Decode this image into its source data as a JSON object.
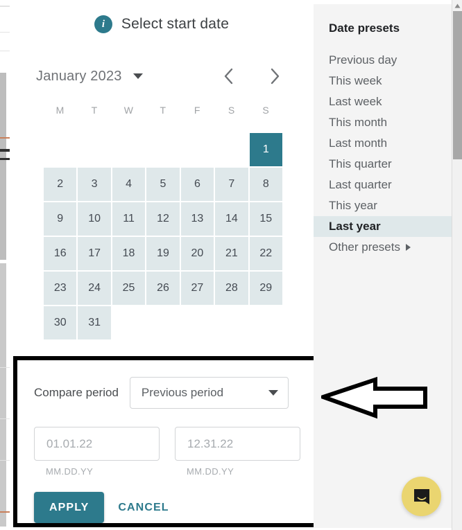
{
  "calendar": {
    "header_title": "Select start date",
    "info_icon": "info-icon",
    "month_label": "January 2023",
    "prev_icon": "chevron-left-icon",
    "next_icon": "chevron-right-icon",
    "dropdown_icon": "chevron-down-icon",
    "weekdays": [
      "M",
      "T",
      "W",
      "T",
      "F",
      "S",
      "S"
    ],
    "leading_blanks": 6,
    "days": [
      1,
      2,
      3,
      4,
      5,
      6,
      7,
      8,
      9,
      10,
      11,
      12,
      13,
      14,
      15,
      16,
      17,
      18,
      19,
      20,
      21,
      22,
      23,
      24,
      25,
      26,
      27,
      28,
      29,
      30,
      31
    ],
    "selected_day": 1,
    "in_range_days": [
      2,
      3,
      4,
      5,
      6,
      7,
      8,
      9,
      10,
      11,
      12,
      13,
      14,
      15,
      16,
      17,
      18,
      19,
      20,
      21,
      22,
      23,
      24,
      25,
      26,
      27,
      28,
      29,
      30,
      31
    ],
    "accent_color": "#2d7a8c",
    "range_color": "#dfe8ea"
  },
  "compare": {
    "label": "Compare period",
    "select_value": "Previous period",
    "select_icon": "chevron-down-icon",
    "start_date": {
      "value": "",
      "placeholder": "01.01.22",
      "hint": "MM.DD.YY"
    },
    "end_date": {
      "value": "",
      "placeholder": "12.31.22",
      "hint": "MM.DD.YY"
    },
    "apply_label": "APPLY",
    "cancel_label": "CANCEL"
  },
  "sidebar": {
    "title": "Date presets",
    "items": [
      {
        "label": "Previous day",
        "active": false,
        "submenu": false
      },
      {
        "label": "This week",
        "active": false,
        "submenu": false
      },
      {
        "label": "Last week",
        "active": false,
        "submenu": false
      },
      {
        "label": "This month",
        "active": false,
        "submenu": false
      },
      {
        "label": "Last month",
        "active": false,
        "submenu": false
      },
      {
        "label": "This quarter",
        "active": false,
        "submenu": false
      },
      {
        "label": "Last quarter",
        "active": false,
        "submenu": false
      },
      {
        "label": "This year",
        "active": false,
        "submenu": false
      },
      {
        "label": "Last year",
        "active": true,
        "submenu": false
      },
      {
        "label": "Other presets",
        "active": false,
        "submenu": true
      }
    ],
    "highlight_color": "#dfe8ea"
  },
  "annotation": {
    "arrow_icon": "left-arrow-annotation-icon",
    "arrow_color": "#000000",
    "box_color": "#000000"
  },
  "messenger": {
    "icon": "chat-bubble-icon",
    "color": "#ead570"
  },
  "scrollbar": {
    "up_icon": "scroll-up-arrow-icon"
  }
}
